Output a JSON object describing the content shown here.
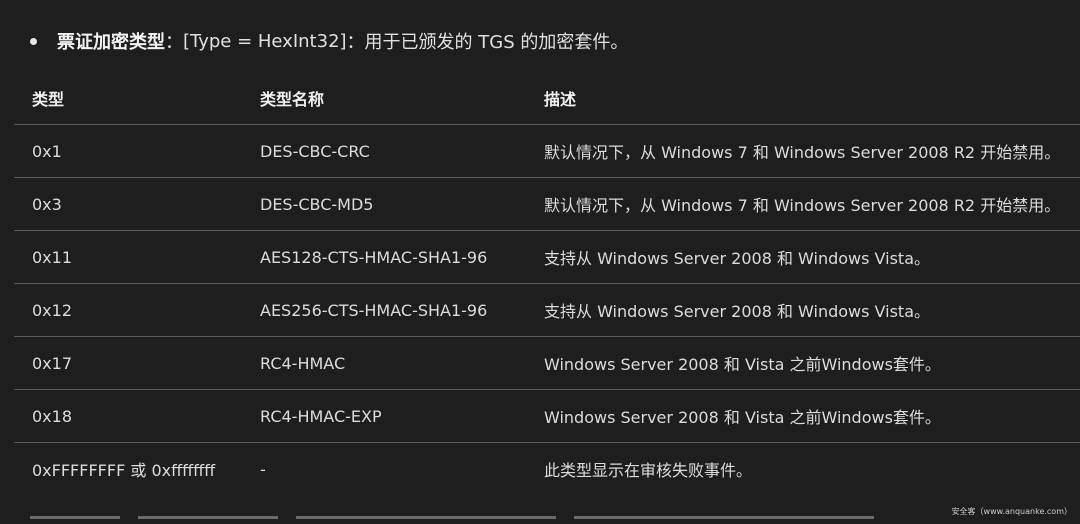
{
  "bullet": {
    "term": "票证加密类型",
    "sep": "：",
    "type_info": "[Type = HexInt32]",
    "desc": "：用于已颁发的 TGS 的加密套件。"
  },
  "table": {
    "headers": [
      "类型",
      "类型名称",
      "描述"
    ],
    "rows": [
      [
        "0x1",
        "DES-CBC-CRC",
        "默认情况下，从 Windows 7 和 Windows Server 2008 R2 开始禁用。"
      ],
      [
        "0x3",
        "DES-CBC-MD5",
        "默认情况下，从 Windows 7 和 Windows Server 2008 R2 开始禁用。"
      ],
      [
        "0x11",
        "AES128-CTS-HMAC-SHA1-96",
        "支持从 Windows Server 2008 和 Windows Vista。"
      ],
      [
        "0x12",
        "AES256-CTS-HMAC-SHA1-96",
        "支持从 Windows Server 2008 和 Windows Vista。"
      ],
      [
        "0x17",
        "RC4-HMAC",
        "Windows Server 2008 和 Vista 之前Windows套件。"
      ],
      [
        "0x18",
        "RC4-HMAC-EXP",
        "Windows Server 2008 和 Vista 之前Windows套件。"
      ],
      [
        "0xFFFFFFFF 或 0xffffffff",
        "-",
        "此类型显示在审核失败事件。"
      ]
    ]
  },
  "watermark": "安全客（www.anquanke.com）"
}
